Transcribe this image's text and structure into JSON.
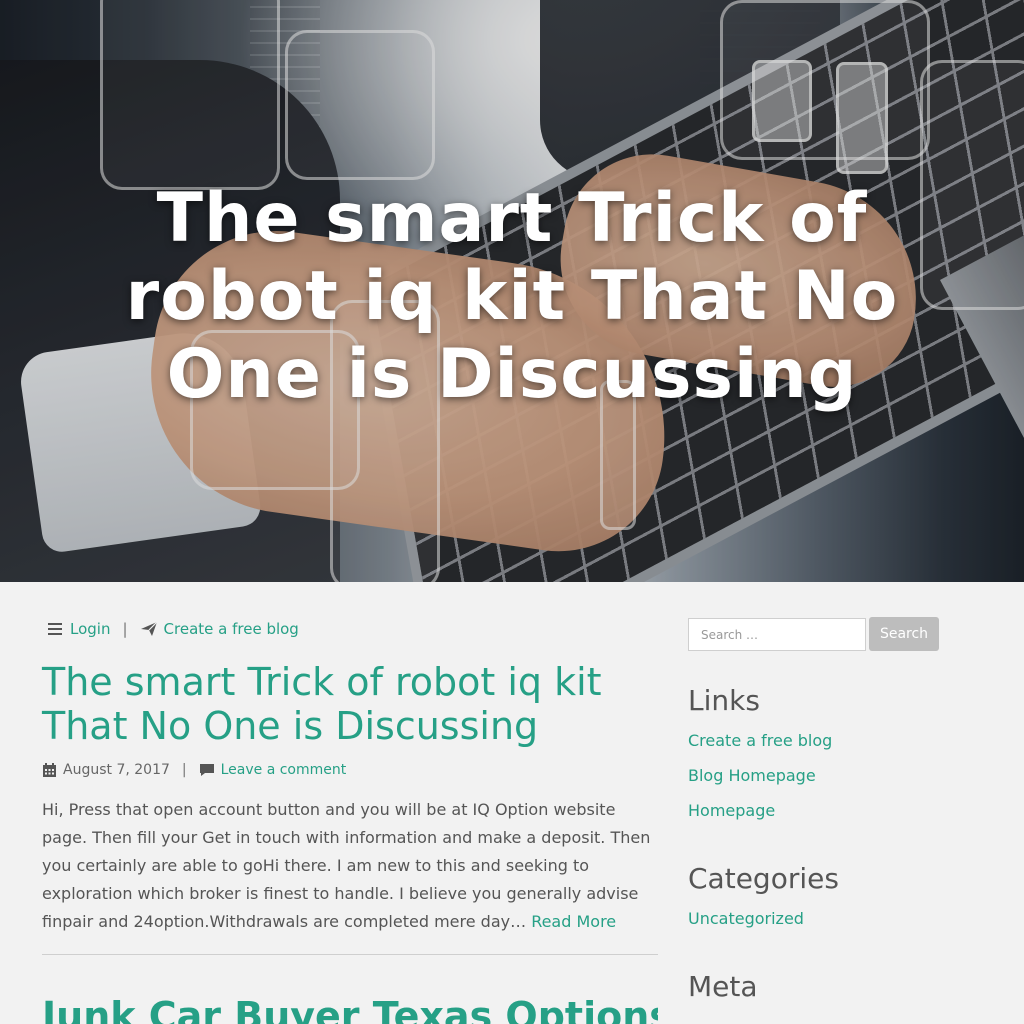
{
  "hero": {
    "title": "The smart Trick of robot iq kit That No One is Discussing"
  },
  "topnav": {
    "login_label": "Login",
    "separator": "|",
    "create_blog_label": "Create a free blog",
    "icons": [
      "bars-icon",
      "paper-plane-icon"
    ]
  },
  "post": {
    "title": "The smart Trick of robot iq kit That No One is Discussing",
    "date": "August 7, 2017",
    "meta_separator": "|",
    "comment_label": "Leave a comment",
    "excerpt": "Hi, Press that open account button and you will be at IQ Option website page. Then fill your Get in touch with information and make a deposit. Then you certainly are able to goHi there. I am new to this and seeking to exploration which broker is finest to handle. I believe you generally advise finpair and 24option.Withdrawals are completed mere day… ",
    "read_more_label": "Read More",
    "icons": [
      "calendar-icon",
      "comment-icon"
    ]
  },
  "next_post": {
    "title": "Junk Car Buyer Texas Options"
  },
  "sidebar": {
    "search": {
      "placeholder": "Search …",
      "button_label": "Search"
    },
    "links": {
      "title": "Links",
      "items": [
        "Create a free blog",
        "Blog Homepage",
        "Homepage"
      ]
    },
    "categories": {
      "title": "Categories",
      "items": [
        "Uncategorized"
      ]
    },
    "meta": {
      "title": "Meta"
    }
  },
  "colors": {
    "accent": "#26a086",
    "background": "#f2f2f2",
    "text": "#555555",
    "button": "#bdbdbd"
  }
}
